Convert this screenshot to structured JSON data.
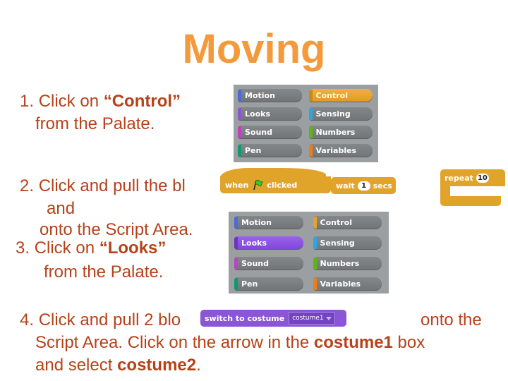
{
  "title": "Moving",
  "steps": {
    "s1": {
      "num": "1.",
      "pre": "Click on ",
      "bold": "“Control”",
      "line2": "from the Palate."
    },
    "s2": {
      "num": "2.",
      "line1": "Click and pull the bl",
      "line2": "and",
      "line3": "onto the Script Area."
    },
    "s3": {
      "num": "3.",
      "pre": "Click on ",
      "bold": "“Looks”",
      "line2": "from the Palate."
    },
    "s4": {
      "num": "4.",
      "line1_pre": "Click and pull 2 blo",
      "line1_post": "onto the",
      "line2_pre": "Script Area.  Click on the arrow in the ",
      "line2_bold": "costume1",
      "line2_post": " box",
      "line3_pre": "and select ",
      "line3_bold": "costume2",
      "line3_post": "."
    }
  },
  "palette_control": {
    "items": [
      {
        "label": "Motion",
        "color": "#4a6cd4"
      },
      {
        "label": "Control",
        "color": "#e1a42a",
        "active": true
      },
      {
        "label": "Looks",
        "color": "#8a55d7"
      },
      {
        "label": "Sensing",
        "color": "#2ca5e2"
      },
      {
        "label": "Sound",
        "color": "#bb42c3"
      },
      {
        "label": "Numbers",
        "color": "#5cb712"
      },
      {
        "label": "Pen",
        "color": "#0e9a6c"
      },
      {
        "label": "Variables",
        "color": "#ee7d16"
      }
    ]
  },
  "palette_looks": {
    "items": [
      {
        "label": "Motion",
        "color": "#4a6cd4"
      },
      {
        "label": "Control",
        "color": "#e1a42a"
      },
      {
        "label": "Looks",
        "color": "#8a55d7",
        "active": true
      },
      {
        "label": "Sensing",
        "color": "#2ca5e2"
      },
      {
        "label": "Sound",
        "color": "#bb42c3"
      },
      {
        "label": "Numbers",
        "color": "#5cb712"
      },
      {
        "label": "Pen",
        "color": "#0e9a6c"
      },
      {
        "label": "Variables",
        "color": "#ee7d16"
      }
    ]
  },
  "blocks": {
    "hat": {
      "pre": "when",
      "post": "clicked",
      "icon": "green-flag-icon"
    },
    "wait": {
      "pre": "wait",
      "value": "1",
      "post": "secs"
    },
    "repeat": {
      "label": "repeat",
      "value": "10"
    },
    "switch": {
      "label": "switch to costume",
      "value": "costume1"
    }
  }
}
